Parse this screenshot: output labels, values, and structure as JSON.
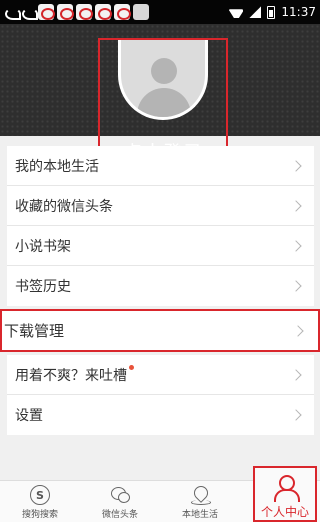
{
  "status_bar": {
    "time": "11:37"
  },
  "header": {
    "login_text": "点击登录"
  },
  "menu_top": [
    {
      "label": "我的本地生活"
    },
    {
      "label": "收藏的微信头条"
    },
    {
      "label": "小说书架"
    },
    {
      "label": "书签历史"
    }
  ],
  "menu_highlight": {
    "label": "下载管理"
  },
  "menu_bottom": [
    {
      "label": "用着不爽？来吐槽",
      "has_dot": true
    },
    {
      "label": "设置"
    }
  ],
  "bottom_nav": {
    "tabs": [
      {
        "label": "搜狗搜索",
        "icon": "sogou-icon"
      },
      {
        "label": "微信头条",
        "icon": "wechat-icon"
      },
      {
        "label": "本地生活",
        "icon": "location-pin-icon"
      }
    ],
    "active_tab": {
      "label": "个人中心",
      "icon": "person-icon"
    }
  },
  "colors": {
    "accent": "#d9262c",
    "header_bg": "#2e2e2e",
    "page_bg": "#f0f0f0"
  }
}
